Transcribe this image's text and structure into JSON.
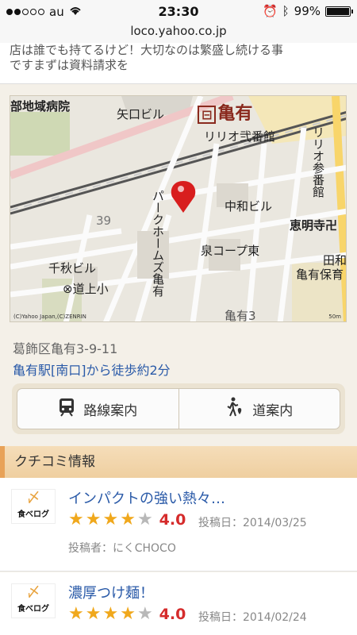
{
  "status": {
    "carrier": "au",
    "time": "23:30",
    "battery": "99%",
    "battery_level": 0.99
  },
  "browser": {
    "url": "loco.yahoo.co.jp"
  },
  "snippet": {
    "line1": "店は誰でも持てるけど！大切なのは繁盛し続ける事",
    "line2": "ですまずは資料請求を"
  },
  "map": {
    "labels": {
      "hospital": "部地域病院",
      "yaguchi": "矢口ビル",
      "station": "亀有",
      "rio2": "リリオ弐番館",
      "rio3": "リリオ参番館",
      "park": "パークホームズ亀有",
      "chuwa": "中和ビル",
      "emmei": "恵明寺卍",
      "num39": "39",
      "senshu": "千秋ビル",
      "school": "道上小",
      "coop": "泉コープ東",
      "tawa": "田和",
      "kameyu": "亀有保育",
      "kameari3": "亀有3"
    },
    "copyright": "(C)Yahoo Japan,(C)ZENRIN",
    "scale": "50m"
  },
  "address": "葛飾区亀有3-9-11",
  "access": "亀有駅[南口]から徒歩約2分",
  "buttons": {
    "route": "路線案内",
    "walk": "道案内"
  },
  "section_title": "クチコミ情報",
  "reviews": [
    {
      "logo": "食べログ",
      "title": "インパクトの強い熱々…",
      "rating": 4,
      "score": "4.0",
      "date": "投稿日：2014/03/25",
      "author": "投稿者：にくCHOCO"
    },
    {
      "logo": "食べログ",
      "title": "濃厚つけ麺！",
      "rating": 4,
      "score": "4.0",
      "date": "投稿日：2014/02/24"
    }
  ],
  "colors": {
    "accent_link": "#2a5aa8",
    "star": "#f0a81c",
    "score": "#d52b2b",
    "section": "#efcfa0"
  }
}
